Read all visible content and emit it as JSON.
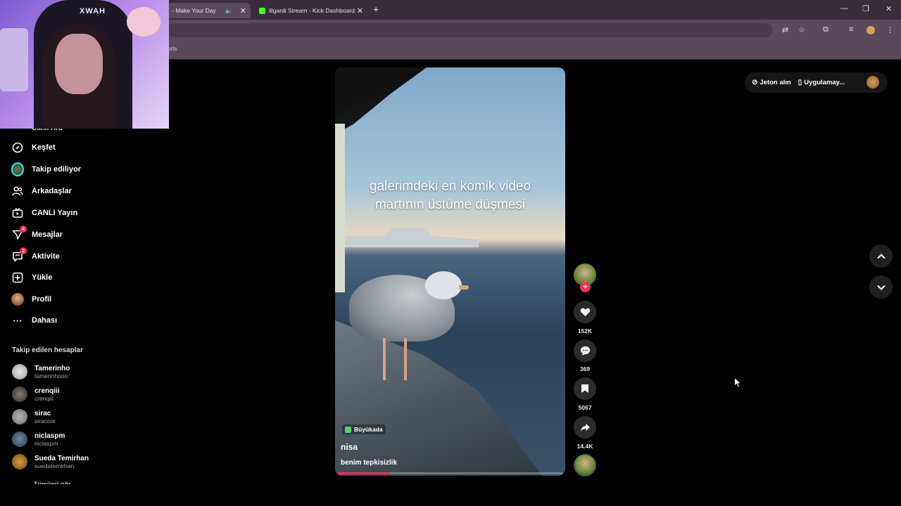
{
  "browser": {
    "tabs": [
      {
        "label": "- Make Your Day",
        "audio_icon": "speaker-icon"
      },
      {
        "label": "lilgardi Stream - Kick Dashboard"
      }
    ],
    "new_tab": "+",
    "bookmarks_text": "orts",
    "window_controls": {
      "minimize": "—",
      "maximize": "❐",
      "close": "✕"
    }
  },
  "webcam": {
    "overlay_text": "XWAH"
  },
  "sidebar": {
    "partial_top_item": "Canlı Ara",
    "items": [
      {
        "label": "Keşfet",
        "icon": "compass-icon"
      },
      {
        "label": "Takip ediliyor",
        "icon": "following-avatar-icon"
      },
      {
        "label": "Arkadaşlar",
        "icon": "friends-icon"
      },
      {
        "label": "CANLI Yayın",
        "icon": "live-icon"
      },
      {
        "label": "Mesajlar",
        "icon": "messages-icon",
        "badge": "4"
      },
      {
        "label": "Aktivite",
        "icon": "activity-icon",
        "badge": "2"
      },
      {
        "label": "Yükle",
        "icon": "upload-icon"
      },
      {
        "label": "Profil",
        "icon": "profile-avatar-icon"
      },
      {
        "label": "Dahası",
        "icon": "more-icon"
      }
    ],
    "followed_title": "Takip edilen hesaplar",
    "accounts": [
      {
        "name": "Tamerinho",
        "handle": "tamerinhooo"
      },
      {
        "name": "crenqiii",
        "handle": "crenqiii"
      },
      {
        "name": "sirac",
        "handle": "siraccor"
      },
      {
        "name": "niclaspm",
        "handle": "niclaspm"
      },
      {
        "name": "Sueda Temirhan",
        "handle": "suedatemirhan"
      }
    ],
    "partial_bottom": "Tümünü gör"
  },
  "video": {
    "caption_line1": "galerimdeki en komik video",
    "caption_line2": "martının üstüme düşmesi",
    "location": "Büyükada",
    "author": "nisa",
    "description": "benim tepkisizlik",
    "progress": 0.23
  },
  "actions": {
    "likes": "152K",
    "comments": "369",
    "saves": "5067",
    "shares": "14.4K"
  },
  "topright": {
    "coins_label": "Jeton alın",
    "app_label": "Uygulamay..."
  },
  "colors": {
    "accent": "#fe2c55",
    "chrome": "#5a4a5c",
    "tabbar": "#3a2d3b"
  }
}
